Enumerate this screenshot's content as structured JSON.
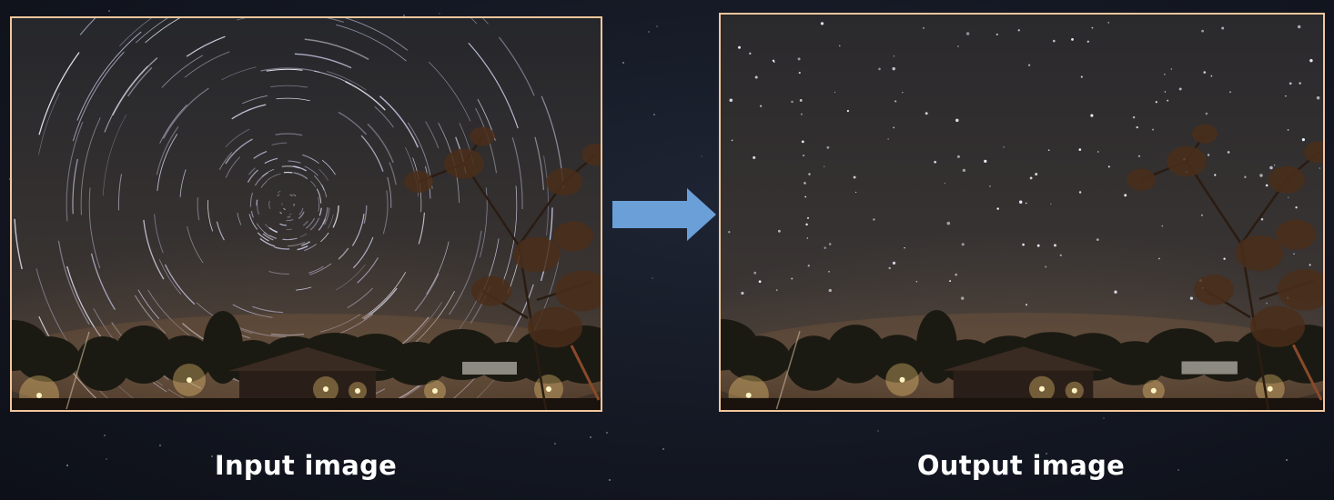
{
  "input_panel": {
    "caption": "Input image",
    "image_name": "star-trails-photo"
  },
  "output_panel": {
    "caption": "Output image",
    "image_name": "point-stars-photo"
  },
  "arrow": {
    "icon": "right-arrow-icon",
    "color": "#6a9fd8"
  },
  "colors": {
    "frame_border": "#f2c79c",
    "background": "#141823",
    "caption_text": "#ffffff"
  }
}
